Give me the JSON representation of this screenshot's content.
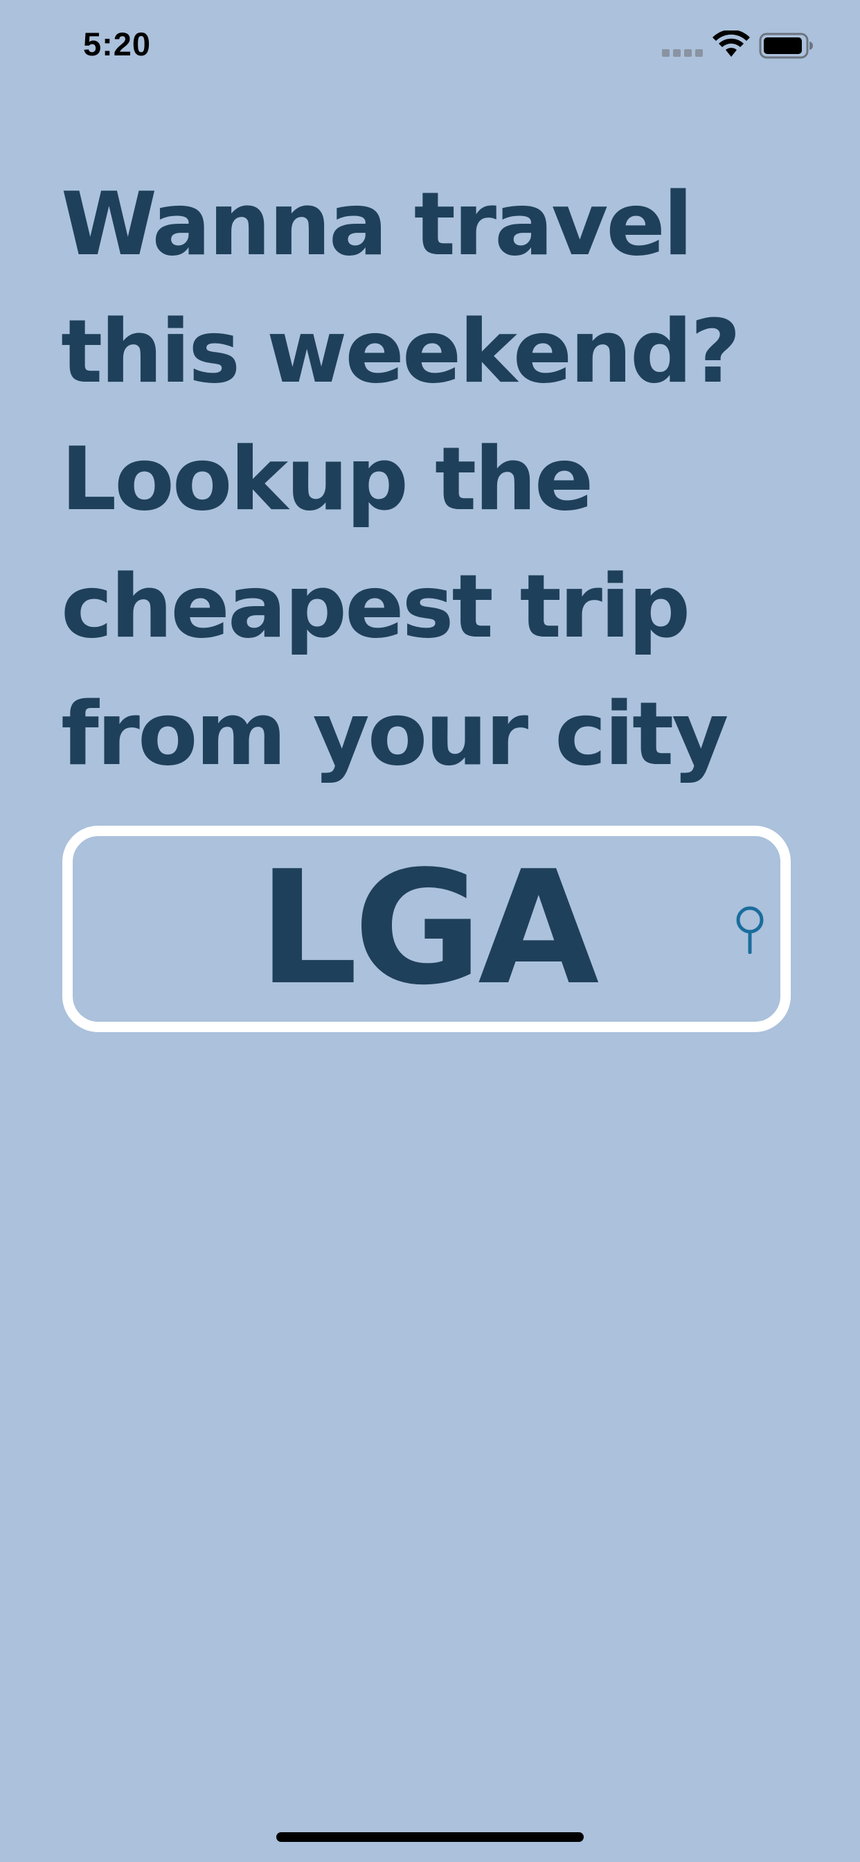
{
  "status_bar": {
    "time": "5:20",
    "signal_icon": "cellular-signal-icon",
    "wifi_icon": "wifi-icon",
    "battery_icon": "battery-icon",
    "battery_level": 0.9
  },
  "headline": {
    "lines": [
      "Wanna travel",
      "this weekend?",
      "Lookup the",
      "cheapest trip",
      "from your city"
    ]
  },
  "search": {
    "value": "LGA",
    "icon": "search-icon"
  },
  "colors": {
    "background": "#abc1dc",
    "text": "#1f405a",
    "border": "#ffffff",
    "search_icon": "#1a6d9c"
  }
}
